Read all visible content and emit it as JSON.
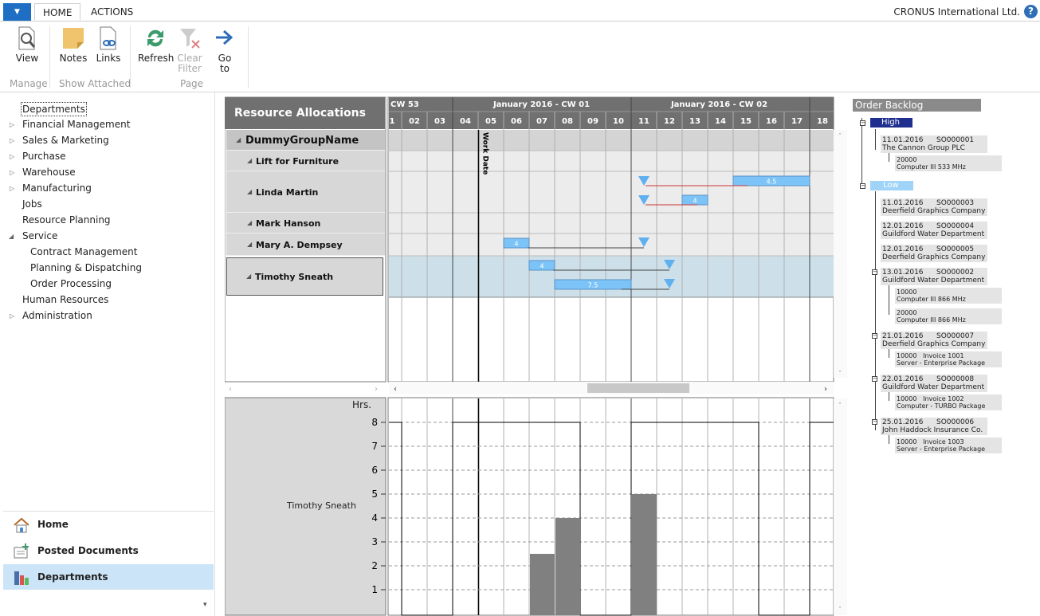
{
  "ribbon": {
    "tabs": [
      "HOME",
      "ACTIONS"
    ],
    "company": "CRONUS International Ltd.",
    "help": "?",
    "buttons": {
      "view": "View",
      "notes": "Notes",
      "links": "Links",
      "refresh": "Refresh",
      "clear_filter": "Clear Filter",
      "goto": "Go to"
    },
    "groups": {
      "manage": "Manage",
      "show_attached": "Show Attached",
      "page": "Page"
    }
  },
  "nav": {
    "items": [
      "Departments",
      "Financial Management",
      "Sales & Marketing",
      "Purchase",
      "Warehouse",
      "Manufacturing",
      "Jobs",
      "Resource Planning",
      "Service",
      "Contract Management",
      "Planning & Dispatching",
      "Order Processing",
      "Human Resources",
      "Administration"
    ],
    "bottom": [
      "Home",
      "Posted Documents",
      "Departments"
    ]
  },
  "schedule": {
    "title": "Resource Allocations",
    "weeks": [
      "CW 53",
      "January 2016 - CW 01",
      "January 2016 - CW 02"
    ],
    "days": [
      "1",
      "02",
      "03",
      "04",
      "05",
      "06",
      "07",
      "08",
      "09",
      "10",
      "11",
      "12",
      "13",
      "14",
      "15",
      "16",
      "17",
      "18"
    ],
    "work_date_label": "Work Date",
    "group": "DummyGroupName",
    "resources": [
      "Lift for Furniture",
      "Linda Martin",
      "Mark Hanson",
      "Mary A. Dempsey",
      "Timothy Sneath"
    ],
    "bars": [
      {
        "resource": "Linda Martin",
        "start": "15",
        "end": "17",
        "label": "4.5"
      },
      {
        "resource": "Linda Martin",
        "start": "13",
        "end": "13",
        "label": "4"
      },
      {
        "resource": "Mary A. Dempsey",
        "start": "06",
        "end": "06",
        "label": "4"
      },
      {
        "resource": "Timothy Sneath",
        "start": "07",
        "end": "07",
        "label": "4"
      },
      {
        "resource": "Timothy Sneath",
        "start": "08",
        "end": "10",
        "label": "7.5"
      }
    ]
  },
  "histogram": {
    "resource": "Timothy Sneath",
    "unit": "Hrs.",
    "y_ticks": [
      "8",
      "7",
      "6",
      "5",
      "4",
      "3",
      "2",
      "1"
    ],
    "capacity_hours": 8,
    "load_hours": {
      "07": 2.5,
      "08": 4,
      "11": 5
    }
  },
  "order_backlog": {
    "title": "Order Backlog",
    "high_label": "High",
    "low_label": "Low",
    "high": [
      {
        "date": "11.01.2016",
        "order": "SO000001",
        "customer": "The Cannon Group PLC",
        "lines": [
          {
            "no": "20000",
            "desc": "Computer III 533 MHz"
          }
        ]
      }
    ],
    "low": [
      {
        "date": "11.01.2016",
        "order": "SO000003",
        "customer": "Deerfield Graphics Company",
        "lines": []
      },
      {
        "date": "12.01.2016",
        "order": "SO000004",
        "customer": "Guildford Water Department",
        "lines": []
      },
      {
        "date": "12.01.2016",
        "order": "SO000005",
        "customer": "Deerfield Graphics Company",
        "lines": []
      },
      {
        "date": "13.01.2016",
        "order": "SO000002",
        "customer": "Guildford Water Department",
        "lines": [
          {
            "no": "10000",
            "desc": "Computer III 866 MHz"
          },
          {
            "no": "20000",
            "desc": "Computer III 866 MHz"
          }
        ]
      },
      {
        "date": "21.01.2016",
        "order": "SO000007",
        "customer": "Deerfield Graphics Company",
        "lines": [
          {
            "no": "10000   Invoice 1001",
            "desc": "Server - Enterprise Package"
          }
        ]
      },
      {
        "date": "22.01.2016",
        "order": "SO000008",
        "customer": "Guildford Water Department",
        "lines": [
          {
            "no": "10000   Invoice 1002",
            "desc": "Computer - TURBO Package"
          }
        ]
      },
      {
        "date": "25.01.2016",
        "order": "SO000006",
        "customer": "John Haddock Insurance Co.",
        "lines": [
          {
            "no": "10000   Invoice 1003",
            "desc": "Server - Enterprise Package"
          }
        ]
      }
    ]
  },
  "colors": {
    "accent": "#1e6fc4",
    "bar": "#7cc4f8",
    "histogram": "#808080",
    "selected_nav": "#cce4f7",
    "high": "#1f2f8f",
    "low": "#9fd3f7"
  }
}
